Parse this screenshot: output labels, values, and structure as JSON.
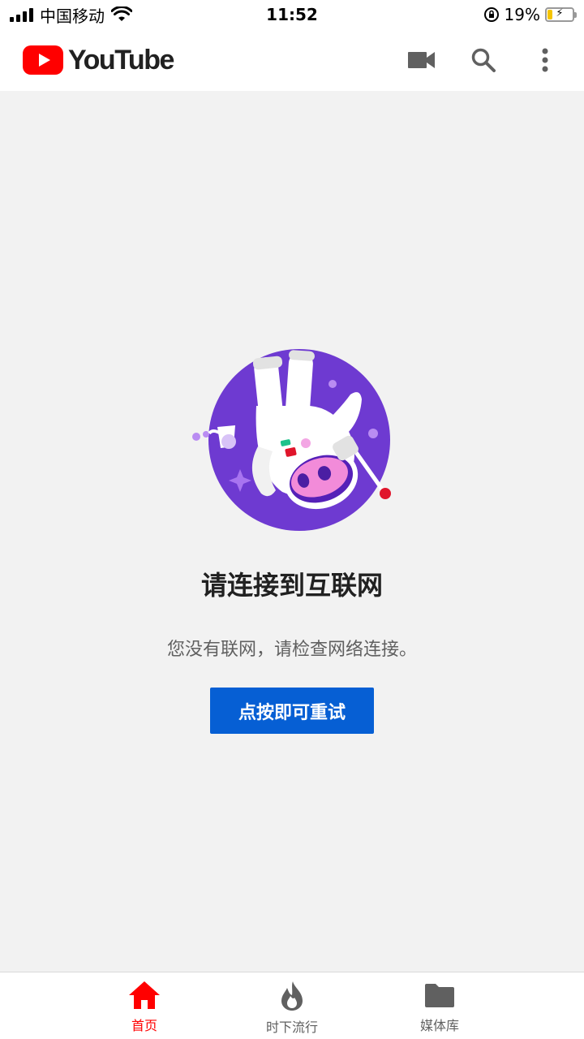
{
  "status_bar": {
    "carrier": "中国移动",
    "time": "11:52",
    "battery": "19%"
  },
  "header": {
    "logo_text": "YouTube",
    "icons": [
      "video-camera-icon",
      "search-icon",
      "more-vert-icon"
    ]
  },
  "main": {
    "title": "请连接到互联网",
    "message": "您没有联网，请检查网络连接。",
    "retry_label": "点按即可重试"
  },
  "bottom_nav": {
    "items": [
      {
        "label": "首页",
        "icon": "home-icon",
        "active": true
      },
      {
        "label": "时下流行",
        "icon": "trending-fire-icon",
        "active": false
      },
      {
        "label": "媒体库",
        "icon": "library-folder-icon",
        "active": false
      }
    ]
  },
  "colors": {
    "brand_red": "#ff0000",
    "button_blue": "#065fd4",
    "illustration_purple": "#6e3ad1",
    "background": "#f2f2f2"
  }
}
